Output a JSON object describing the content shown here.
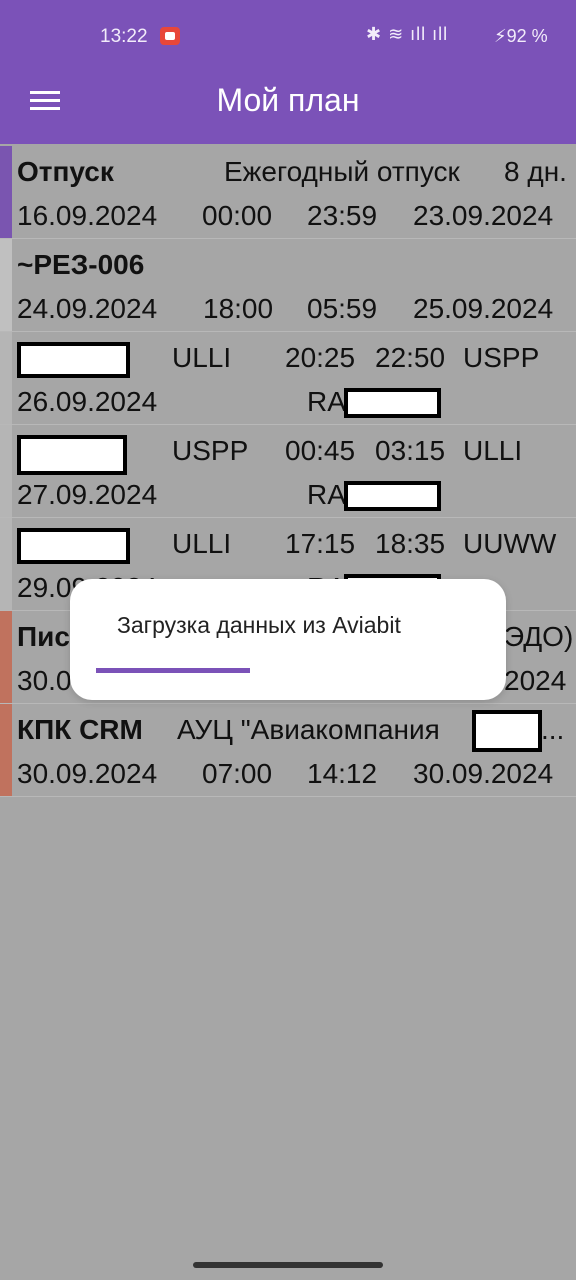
{
  "status_bar": {
    "time": "13:22",
    "icons": "✱ ≋ ıll ıll",
    "battery": "⚡92 %"
  },
  "app_bar": {
    "title": "Мой план"
  },
  "rows": [
    {
      "accent": "#7a55b0",
      "line1": [
        "Отпуск",
        "Ежегодный отпуск",
        "8 дн."
      ],
      "line2": [
        "16.09.2024",
        "00:00",
        "23:59",
        "23.09.2024"
      ]
    },
    {
      "accent": "#c0c0c0",
      "line1": [
        "~РЕЗ-006"
      ],
      "line2": [
        "24.09.2024",
        "18:00",
        "05:59",
        "25.09.2024"
      ]
    },
    {
      "accent": "#b5b5b5",
      "line1": [
        "ULLI",
        "20:25",
        "22:50",
        "USPP"
      ],
      "line2": [
        "26.09.2024",
        "RA"
      ]
    },
    {
      "accent": "#b5b5b5",
      "line1": [
        "USPP",
        "00:45",
        "03:15",
        "ULLI"
      ],
      "line2": [
        "27.09.2024",
        "RA"
      ]
    },
    {
      "accent": "#b5b5b5",
      "line1": [
        "ULLI",
        "17:15",
        "18:35",
        "UUWW"
      ],
      "line2": [
        "29.09.2024",
        "RA"
      ]
    },
    {
      "accent": "#c0725e",
      "line1": [
        "Пис",
        "ЭДО)"
      ],
      "line2": [
        "30.0",
        "2024"
      ]
    },
    {
      "accent": "#c0725e",
      "line1": [
        "КПК CRM",
        "АУЦ \"Авиакомпания",
        "..."
      ],
      "line2": [
        "30.09.2024",
        "07:00",
        "14:12",
        "30.09.2024"
      ]
    }
  ],
  "dialog": {
    "message": "Загрузка данных из Aviabit",
    "progress": 0.4
  }
}
